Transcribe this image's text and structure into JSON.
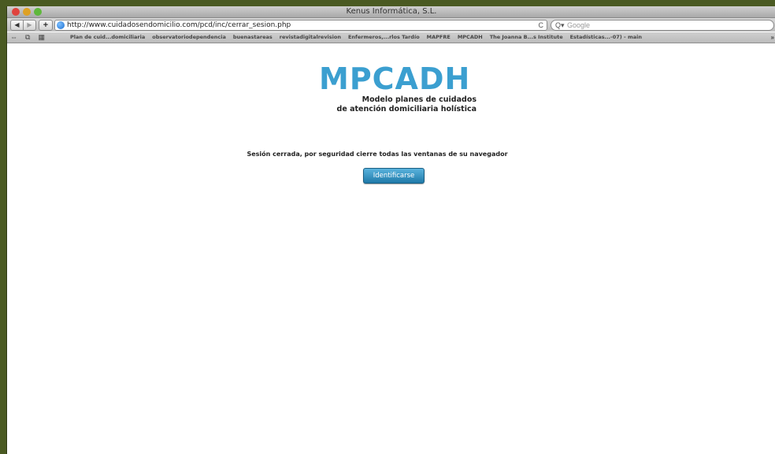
{
  "window": {
    "title": "Kenus Informática, S.L."
  },
  "navbar": {
    "back_icon": "◀",
    "forward_icon": "▶",
    "add_icon": "+",
    "url": "http://www.cuidadosendomicilio.com/pcd/inc/cerrar_sesion.php",
    "reload_icon": "C",
    "search_icon": "Q▾",
    "search_placeholder": "Google"
  },
  "bookmarks": {
    "icons": [
      "⇔",
      "⧉",
      "▦"
    ],
    "items": [
      "Plan de cuid...domiciliaria",
      "observatoriodependencia",
      "buenastareas",
      "revistadigitalrevision",
      "Enfermeros,...rlos Tardío",
      "MAPFRE",
      "MPCADH",
      "The Joanna B...s Institute",
      "Estadísticas...-07) - main"
    ],
    "more": "»"
  },
  "page": {
    "logo": "MPCADH",
    "subtitle_line1": "Modelo planes de cuidados",
    "subtitle_line2": "de atención domiciliaria holística",
    "message": "Sesión cerrada, por seguridad cierre todas las ventanas de su navegador",
    "button_label": "Identificarse"
  },
  "colors": {
    "logo": "#3b9fd0",
    "button": "#2b8fc0",
    "frame": "#4a5a22"
  }
}
